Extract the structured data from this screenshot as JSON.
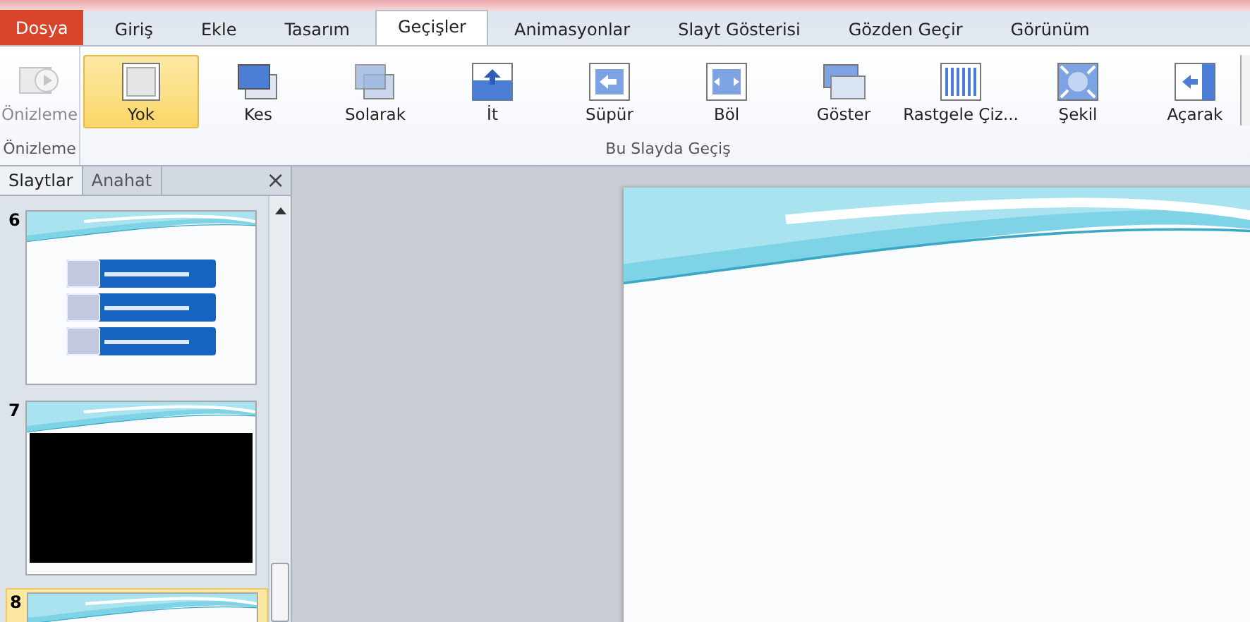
{
  "tabs": [
    {
      "label": "Dosya",
      "kind": "file",
      "selected": false
    },
    {
      "label": "Giriş",
      "kind": "tab",
      "selected": false
    },
    {
      "label": "Ekle",
      "kind": "tab",
      "selected": false
    },
    {
      "label": "Tasarım",
      "kind": "tab",
      "selected": false
    },
    {
      "label": "Geçişler",
      "kind": "tab",
      "selected": true
    },
    {
      "label": "Animasyonlar",
      "kind": "tab",
      "selected": false
    },
    {
      "label": "Slayt Gösterisi",
      "kind": "tab",
      "selected": false
    },
    {
      "label": "Gözden Geçir",
      "kind": "tab",
      "selected": false
    },
    {
      "label": "Görünüm",
      "kind": "tab",
      "selected": false
    }
  ],
  "ribbon": {
    "groups": [
      {
        "label": "Önizleme",
        "items": [
          {
            "label": "Önizleme",
            "kind": "preview",
            "selected": false,
            "disabled": true
          }
        ]
      },
      {
        "label": "Bu Slayda Geçiş",
        "items": [
          {
            "label": "Yok",
            "kind": "none",
            "selected": true,
            "disabled": false
          },
          {
            "label": "Kes",
            "kind": "cut",
            "selected": false,
            "disabled": false
          },
          {
            "label": "Solarak",
            "kind": "fade",
            "selected": false,
            "disabled": false
          },
          {
            "label": "İt",
            "kind": "push",
            "selected": false,
            "disabled": false
          },
          {
            "label": "Süpür",
            "kind": "wipe",
            "selected": false,
            "disabled": false
          },
          {
            "label": "Böl",
            "kind": "split",
            "selected": false,
            "disabled": false
          },
          {
            "label": "Göster",
            "kind": "reveal",
            "selected": false,
            "disabled": false
          },
          {
            "label": "Rastgele Çiz...",
            "kind": "bars",
            "selected": false,
            "disabled": false
          },
          {
            "label": "Şekil",
            "kind": "shape",
            "selected": false,
            "disabled": false
          },
          {
            "label": "Açarak",
            "kind": "uncover",
            "selected": false,
            "disabled": false
          }
        ]
      }
    ]
  },
  "pane": {
    "tabs": [
      {
        "label": "Slaytlar",
        "selected": true
      },
      {
        "label": "Anahat",
        "selected": false
      }
    ],
    "close": "×",
    "slides": [
      {
        "number": "6",
        "kind": "boxes",
        "selected": false
      },
      {
        "number": "7",
        "kind": "video",
        "selected": false
      },
      {
        "number": "8",
        "kind": "blank",
        "selected": true
      }
    ]
  }
}
